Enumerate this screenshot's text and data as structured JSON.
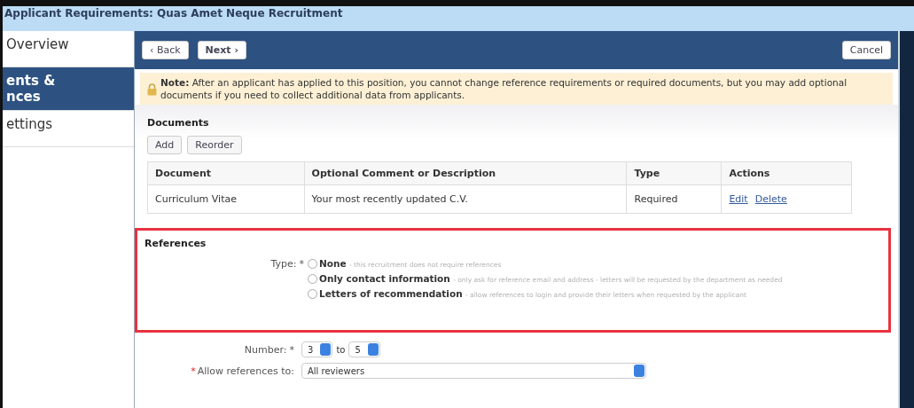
{
  "window": {
    "title": "Applicant Requirements: Quas Amet Neque Recruitment"
  },
  "sidebar": {
    "items": [
      {
        "label": "Overview",
        "selected": false
      },
      {
        "label": "ents &\nnces",
        "selected": true
      },
      {
        "label": "ettings",
        "selected": false
      }
    ]
  },
  "toolbar": {
    "back": "‹ Back",
    "next": "Next ›",
    "cancel": "Cancel"
  },
  "note": {
    "label": "Note:",
    "text": "After an applicant has applied to this position, you cannot change reference requirements or required documents, but you may add optional documents if you need to collect additional data from applicants."
  },
  "documents": {
    "title": "Documents",
    "buttons": [
      "Add",
      "Reorder"
    ],
    "columns": [
      "Document",
      "Optional Comment or Description",
      "Type",
      "Actions"
    ],
    "rows": [
      {
        "document": "Curriculum Vitae",
        "description": "Your most recently updated C.V.",
        "type": "Required",
        "actions": [
          "Edit",
          "Delete"
        ]
      }
    ]
  },
  "references": {
    "title": "References",
    "type_label": "Type:",
    "required_mark": "*",
    "options": [
      {
        "label": "None",
        "hint": "- this recruitment does not require references",
        "selected": false
      },
      {
        "label": "Only contact information",
        "hint": "- only ask for reference email and address - letters will be requested by the department as needed",
        "selected": false
      },
      {
        "label": "Letters of recommendation",
        "hint": "- allow references to login and provide their letters when requested by the applicant",
        "selected": false
      }
    ]
  },
  "number": {
    "label": "Number:",
    "required_mark": "*",
    "from": "3",
    "to_label": "to",
    "to": "5"
  },
  "allow": {
    "required_mark": "*",
    "label": "Allow references to:",
    "value": "All reviewers"
  }
}
